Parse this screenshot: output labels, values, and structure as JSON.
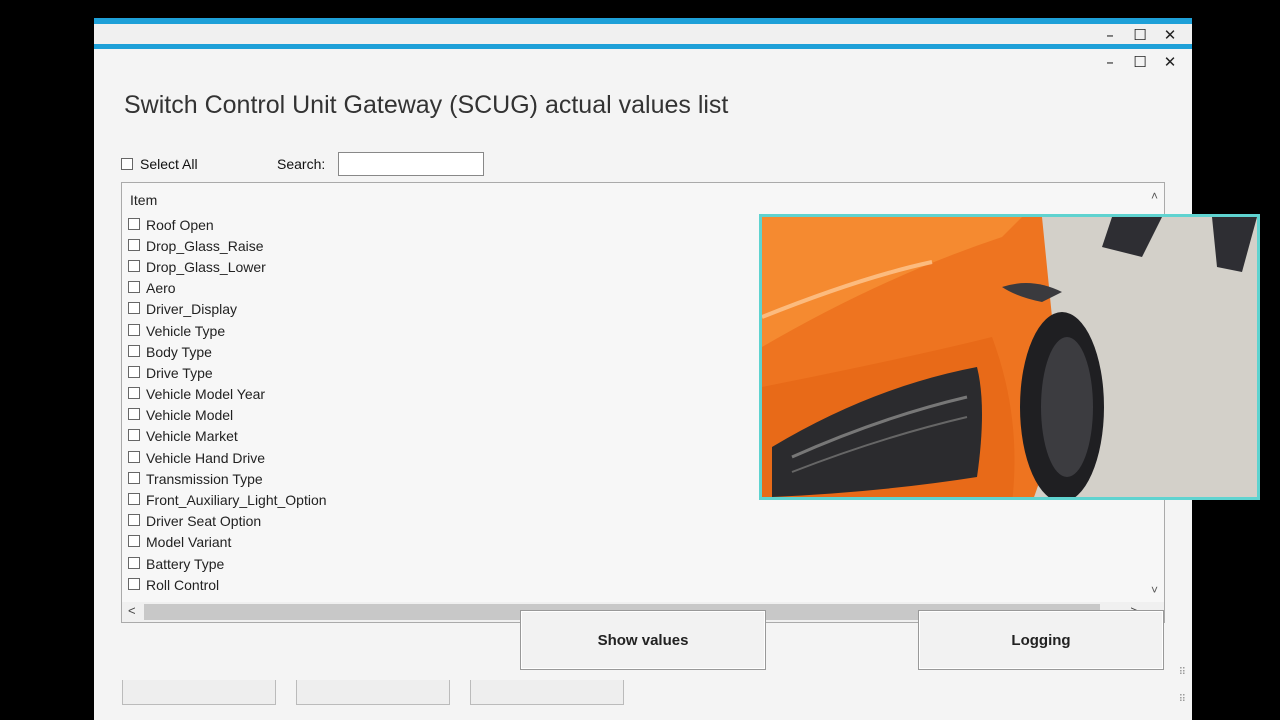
{
  "window": {
    "title": "Switch Control Unit Gateway (SCUG) actual values list",
    "controls": {
      "minimize": "–",
      "maximize": "☐",
      "close": "✕"
    }
  },
  "toolbar": {
    "select_all_label": "Select All",
    "search_label": "Search:",
    "search_value": ""
  },
  "list": {
    "column_header": "Item",
    "items": [
      "Roof Open",
      "Drop_Glass_Raise",
      "Drop_Glass_Lower",
      "Aero",
      "Driver_Display",
      "Vehicle Type",
      "Body Type",
      "Drive Type",
      "Vehicle Model Year",
      "Vehicle Model",
      "Vehicle Market",
      "Vehicle Hand Drive",
      "Transmission Type",
      "Front_Auxiliary_Light_Option",
      "Driver Seat Option",
      "Model Variant",
      "Battery Type",
      "Roll Control"
    ],
    "scroll_up": "˄",
    "scroll_down": "˅",
    "scroll_left": "<",
    "scroll_right": ">"
  },
  "buttons": {
    "show_values": "Show values",
    "logging": "Logging"
  },
  "colors": {
    "accent": "#1ea0d8",
    "video_border": "#5fd3d0",
    "car_orange": "#f27a22"
  },
  "icons": {
    "minimize": "minimize-icon",
    "maximize": "maximize-icon",
    "close": "close-icon",
    "resize_grip": "resize-grip-icon"
  }
}
